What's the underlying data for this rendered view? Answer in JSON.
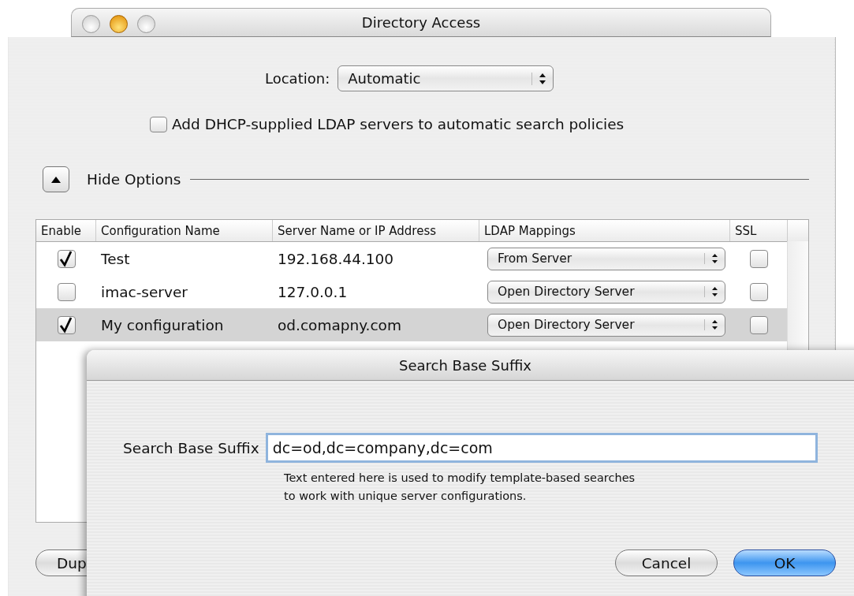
{
  "main_window": {
    "title": "Directory Access",
    "location": {
      "label": "Location:",
      "value": "Automatic"
    },
    "dhcp_option": {
      "label": "Add DHCP-supplied LDAP servers to automatic search policies",
      "checked": false
    },
    "options_toggle": {
      "label": "Hide Options",
      "expanded": true
    },
    "table": {
      "columns": [
        "Enable",
        "Configuration Name",
        "Server Name or IP Address",
        "LDAP Mappings",
        "SSL"
      ],
      "rows": [
        {
          "enabled": true,
          "name": "Test",
          "server": "192.168.44.100",
          "mapping": "From Server",
          "ssl": false,
          "selected": false
        },
        {
          "enabled": false,
          "name": "imac-server",
          "server": "127.0.0.1",
          "mapping": "Open Directory Server",
          "ssl": false,
          "selected": false
        },
        {
          "enabled": true,
          "name": "My configuration",
          "server": "od.comapny.com",
          "mapping": "Open Directory Server",
          "ssl": false,
          "selected": true
        }
      ]
    },
    "buttons": [
      "Dup"
    ]
  },
  "sheet": {
    "title": "Search Base Suffix",
    "field": {
      "label": "Search Base Suffix",
      "value": "dc=od,dc=company,dc=com"
    },
    "help": "Text entered here is used to modify template-based searches\nto work with unique server configurations.",
    "buttons": [
      {
        "label": "Cancel",
        "default": false
      },
      {
        "label": "OK",
        "default": true
      }
    ]
  }
}
